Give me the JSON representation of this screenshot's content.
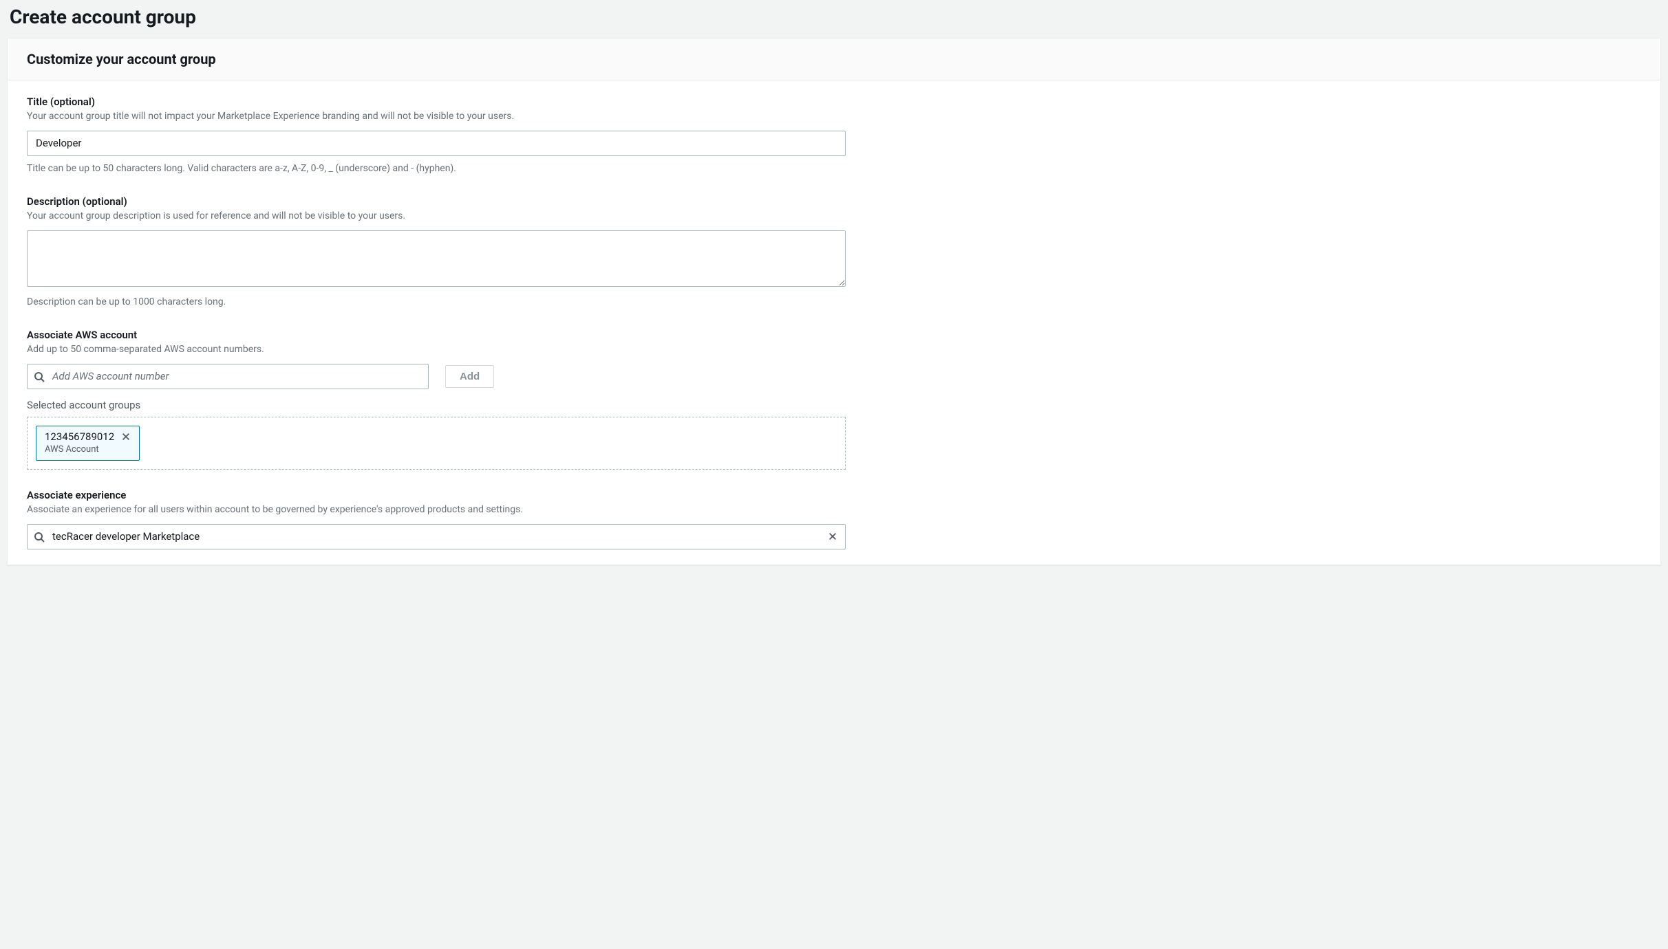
{
  "page": {
    "title": "Create account group"
  },
  "card": {
    "header": "Customize your account group"
  },
  "title_field": {
    "label": "Title (optional)",
    "help": "Your account group title will not impact your Marketplace Experience branding and will not be visible to your users.",
    "value": "Developer",
    "hint": "Title can be up to 50 characters long. Valid characters are a-z, A-Z, 0-9, _ (underscore) and - (hyphen)."
  },
  "description_field": {
    "label": "Description (optional)",
    "help": "Your account group description is used for reference and will not be visible to your users.",
    "value": "",
    "hint": "Description can be up to 1000 characters long."
  },
  "associate_account": {
    "label": "Associate AWS account",
    "help": "Add up to 50 comma-separated AWS account numbers.",
    "placeholder": "Add AWS account number",
    "add_button": "Add",
    "selected_label": "Selected account groups",
    "selected": [
      {
        "number": "123456789012",
        "type": "AWS Account"
      }
    ]
  },
  "associate_experience": {
    "label": "Associate experience",
    "help": "Associate an experience for all users within account to be governed by experience's approved products and settings.",
    "value": "tecRacer developer Marketplace"
  }
}
